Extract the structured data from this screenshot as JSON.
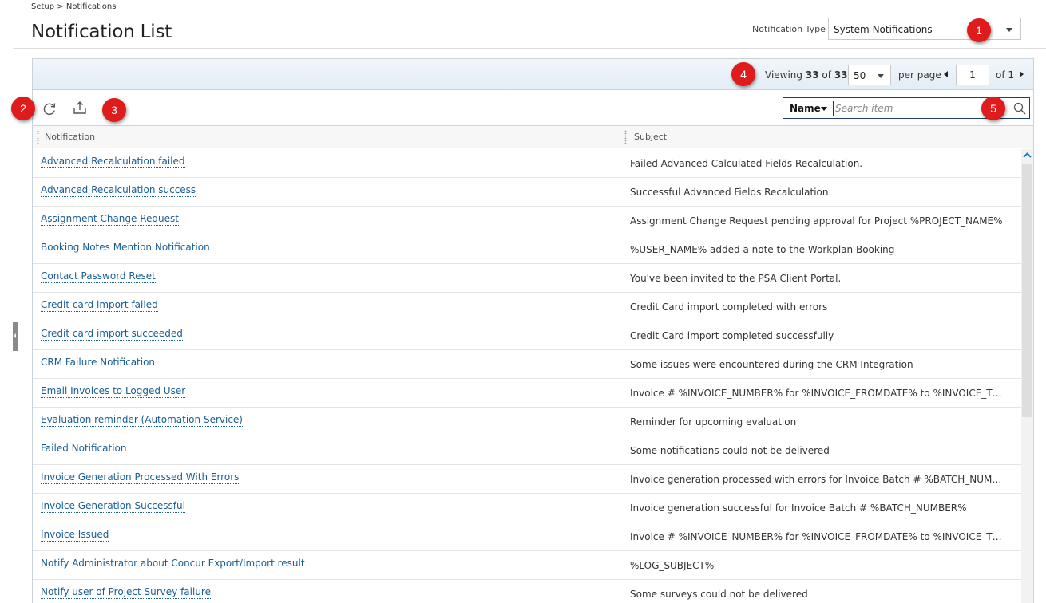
{
  "breadcrumb": "Setup > Notifications",
  "page_title": "Notification List",
  "notification_type": {
    "label": "Notification Type",
    "selected": "System Notifications"
  },
  "pager": {
    "viewing_prefix": "Viewing",
    "shown": "33",
    "of_word": "of",
    "total": "33",
    "per_page_value": "50",
    "per_page_label": "per page",
    "page": "1",
    "of_pages": "of 1"
  },
  "toolbar": {
    "refresh_icon": "refresh-icon",
    "export_icon": "export-icon"
  },
  "search": {
    "field": "Name",
    "placeholder": "Search item",
    "icon": "search-icon"
  },
  "columns": [
    "Notification",
    "Subject"
  ],
  "rows": [
    {
      "name": "Advanced Recalculation failed",
      "subject": "Failed Advanced Calculated Fields Recalculation."
    },
    {
      "name": "Advanced Recalculation success",
      "subject": "Successful Advanced Fields Recalculation."
    },
    {
      "name": "Assignment Change Request",
      "subject": "Assignment Change Request pending approval for Project %PROJECT_NAME%"
    },
    {
      "name": "Booking Notes Mention Notification",
      "subject": "%USER_NAME% added a note to the Workplan Booking"
    },
    {
      "name": "Contact Password Reset",
      "subject": "You've been invited to the PSA Client Portal."
    },
    {
      "name": "Credit card import failed",
      "subject": "Credit Card import completed with errors"
    },
    {
      "name": "Credit card import succeeded",
      "subject": "Credit Card import completed successfully"
    },
    {
      "name": "CRM Failure Notification",
      "subject": "Some issues were encountered during the CRM Integration"
    },
    {
      "name": "Email Invoices to Logged User",
      "subject": "Invoice # %INVOICE_NUMBER% for %INVOICE_FROMDATE% to %INVOICE_TODAT..."
    },
    {
      "name": "Evaluation reminder (Automation Service)",
      "subject": "Reminder for upcoming evaluation"
    },
    {
      "name": "Failed Notification",
      "subject": "Some notifications could not be delivered"
    },
    {
      "name": "Invoice Generation Processed With Errors",
      "subject": "Invoice generation processed with errors for Invoice Batch # %BATCH_NUMBER%"
    },
    {
      "name": "Invoice Generation Successful",
      "subject": "Invoice generation successful for Invoice Batch # %BATCH_NUMBER%"
    },
    {
      "name": "Invoice Issued",
      "subject": "Invoice # %INVOICE_NUMBER% for %INVOICE_FROMDATE% to %INVOICE_TODAT..."
    },
    {
      "name": "Notify Administrator about Concur Export/Import result",
      "subject": "%LOG_SUBJECT%"
    },
    {
      "name": "Notify user of Project Survey failure",
      "subject": "Some surveys could not be delivered"
    }
  ],
  "callouts": [
    "1",
    "2",
    "3",
    "4",
    "5"
  ],
  "colors": {
    "link": "#1a5d96",
    "badge": "#e01b1b",
    "pager_bg": "#e8f0f7",
    "search_border": "#1f3f6b"
  }
}
